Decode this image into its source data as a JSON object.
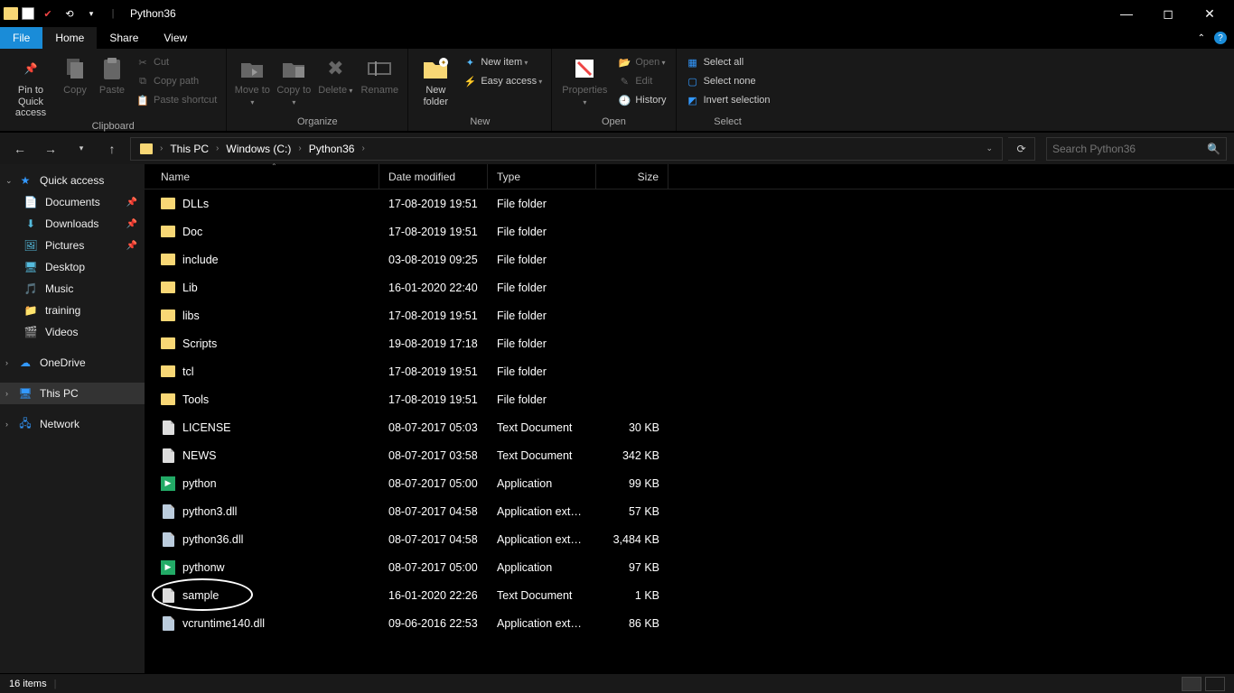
{
  "window": {
    "title": "Python36"
  },
  "tabs": {
    "file": "File",
    "home": "Home",
    "share": "Share",
    "view": "View"
  },
  "ribbon": {
    "clipboard": {
      "label": "Clipboard",
      "pin": "Pin to Quick access",
      "copy": "Copy",
      "paste": "Paste",
      "cut": "Cut",
      "copy_path": "Copy path",
      "paste_shortcut": "Paste shortcut"
    },
    "organize": {
      "label": "Organize",
      "move_to": "Move to",
      "copy_to": "Copy to",
      "delete": "Delete",
      "rename": "Rename"
    },
    "new": {
      "label": "New",
      "new_folder": "New folder",
      "new_item": "New item",
      "easy_access": "Easy access"
    },
    "open": {
      "label": "Open",
      "properties": "Properties",
      "open": "Open",
      "edit": "Edit",
      "history": "History"
    },
    "select": {
      "label": "Select",
      "select_all": "Select all",
      "select_none": "Select none",
      "invert": "Invert selection"
    }
  },
  "breadcrumb": {
    "this_pc": "This PC",
    "drive": "Windows (C:)",
    "folder": "Python36"
  },
  "search": {
    "placeholder": "Search Python36"
  },
  "sidebar": {
    "quick_access": "Quick access",
    "items": [
      {
        "label": "Documents",
        "pin": true
      },
      {
        "label": "Downloads",
        "pin": true
      },
      {
        "label": "Pictures",
        "pin": true
      },
      {
        "label": "Desktop",
        "pin": false
      },
      {
        "label": "Music",
        "pin": false
      },
      {
        "label": "training",
        "pin": false
      },
      {
        "label": "Videos",
        "pin": false
      }
    ],
    "onedrive": "OneDrive",
    "this_pc": "This PC",
    "network": "Network"
  },
  "columns": {
    "name": "Name",
    "date": "Date modified",
    "type": "Type",
    "size": "Size"
  },
  "files": [
    {
      "name": "DLLs",
      "date": "17-08-2019 19:51",
      "type": "File folder",
      "size": "",
      "kind": "folder"
    },
    {
      "name": "Doc",
      "date": "17-08-2019 19:51",
      "type": "File folder",
      "size": "",
      "kind": "folder"
    },
    {
      "name": "include",
      "date": "03-08-2019 09:25",
      "type": "File folder",
      "size": "",
      "kind": "folder"
    },
    {
      "name": "Lib",
      "date": "16-01-2020 22:40",
      "type": "File folder",
      "size": "",
      "kind": "folder"
    },
    {
      "name": "libs",
      "date": "17-08-2019 19:51",
      "type": "File folder",
      "size": "",
      "kind": "folder"
    },
    {
      "name": "Scripts",
      "date": "19-08-2019 17:18",
      "type": "File folder",
      "size": "",
      "kind": "folder"
    },
    {
      "name": "tcl",
      "date": "17-08-2019 19:51",
      "type": "File folder",
      "size": "",
      "kind": "folder"
    },
    {
      "name": "Tools",
      "date": "17-08-2019 19:51",
      "type": "File folder",
      "size": "",
      "kind": "folder"
    },
    {
      "name": "LICENSE",
      "date": "08-07-2017 05:03",
      "type": "Text Document",
      "size": "30 KB",
      "kind": "file"
    },
    {
      "name": "NEWS",
      "date": "08-07-2017 03:58",
      "type": "Text Document",
      "size": "342 KB",
      "kind": "file"
    },
    {
      "name": "python",
      "date": "08-07-2017 05:00",
      "type": "Application",
      "size": "99 KB",
      "kind": "app"
    },
    {
      "name": "python3.dll",
      "date": "08-07-2017 04:58",
      "type": "Application exten...",
      "size": "57 KB",
      "kind": "dll"
    },
    {
      "name": "python36.dll",
      "date": "08-07-2017 04:58",
      "type": "Application exten...",
      "size": "3,484 KB",
      "kind": "dll"
    },
    {
      "name": "pythonw",
      "date": "08-07-2017 05:00",
      "type": "Application",
      "size": "97 KB",
      "kind": "app"
    },
    {
      "name": "sample",
      "date": "16-01-2020 22:26",
      "type": "Text Document",
      "size": "1 KB",
      "kind": "file",
      "circled": true
    },
    {
      "name": "vcruntime140.dll",
      "date": "09-06-2016 22:53",
      "type": "Application exten...",
      "size": "86 KB",
      "kind": "dll"
    }
  ],
  "status": {
    "count": "16 items"
  }
}
